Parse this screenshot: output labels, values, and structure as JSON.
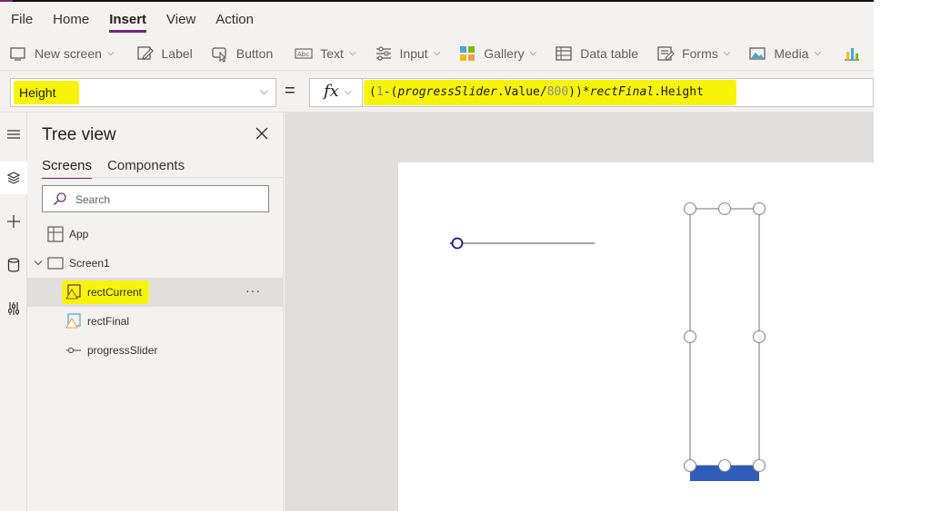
{
  "menu": {
    "items": [
      {
        "label": "File"
      },
      {
        "label": "Home"
      },
      {
        "label": "Insert",
        "active": true
      },
      {
        "label": "View"
      },
      {
        "label": "Action"
      }
    ]
  },
  "ribbon": {
    "new_screen": "New screen",
    "label": "Label",
    "button": "Button",
    "text": "Text",
    "input": "Input",
    "gallery": "Gallery",
    "data_table": "Data table",
    "forms": "Forms",
    "media": "Media"
  },
  "formula_bar": {
    "property": "Height",
    "equals": "=",
    "fx": "fx",
    "formula_parts": {
      "p1": "(",
      "n1": "1",
      "p2": "-(",
      "ref1": "progressSlider",
      "p3": ".Value/",
      "n2": "800",
      "p4": "))*",
      "ref2": "rectFinal",
      "p5": ".Height"
    }
  },
  "tree_view": {
    "title": "Tree view",
    "tabs": [
      {
        "label": "Screens",
        "active": true
      },
      {
        "label": "Components"
      }
    ],
    "search_placeholder": "Search",
    "nodes": {
      "app": "App",
      "screen1": "Screen1",
      "rect_current": "rectCurrent",
      "rect_final": "rectFinal",
      "progress_slider": "progressSlider"
    },
    "more": "···"
  },
  "canvas": {
    "slider_value_fraction": 0.0
  },
  "colors": {
    "accent": "#742774",
    "highlight": "#f7f40a",
    "rect_fill": "#2f5cb9",
    "slider_knob": "#1b1b7e"
  }
}
